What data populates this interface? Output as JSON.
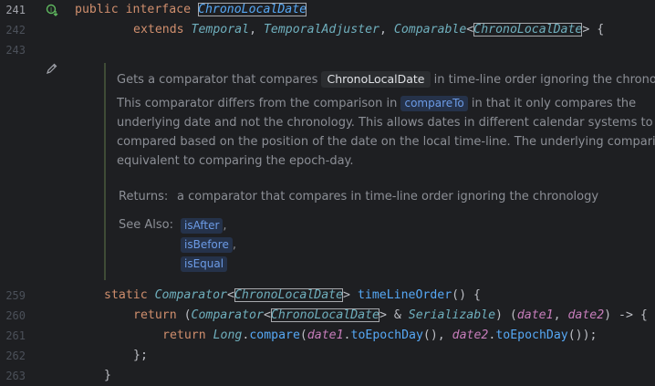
{
  "gutter": {
    "lines": [
      "241",
      "242",
      "243",
      "259",
      "260",
      "261",
      "262",
      "263"
    ]
  },
  "code": {
    "l241_kw1": "public",
    "l241_kw2": "interface",
    "l241_name": "ChronoLocalDate",
    "l242_kw": "extends",
    "l242_t1": "Temporal",
    "l242_t2": "TemporalAdjuster",
    "l242_t3": "Comparable",
    "l242_t4": "ChronoLocalDate",
    "l242_end": "> {",
    "l259_kw": "static",
    "l259_t1": "Comparator",
    "l259_t2": "ChronoLocalDate",
    "l259_fn": "timeLineOrder",
    "l259_end": "() {",
    "l260_kw": "return",
    "l260_t1": "Comparator",
    "l260_t2": "ChronoLocalDate",
    "l260_t3": "Serializable",
    "l260_p1": "date1",
    "l260_p2": "date2",
    "l261_kw": "return",
    "l261_cls": "Long",
    "l261_m1": "compare",
    "l261_a1": "date1",
    "l261_m2": "toEpochDay",
    "l261_a2": "date2",
    "l261_m3": "toEpochDay",
    "l262": "};",
    "l263": "}"
  },
  "doc": {
    "line1_pre": "Gets a comparator that compares",
    "line1_chip": "ChronoLocalDate",
    "line1_post": "in time-line order ignoring the chronology",
    "line2_pre": "This comparator differs from the comparison in",
    "line2_link": "compareTo",
    "line2_post": "in that it only compares the",
    "line3": "underlying date and not the chronology. This allows dates in different calendar systems to be",
    "line4": "compared based on the position of the date on the local time-line. The underlying comparison",
    "line5": "equivalent to comparing the epoch-day.",
    "returns_label": "Returns:",
    "returns_text": "a comparator that compares in time-line order ignoring the chronology",
    "see_also_label": "See Also:",
    "see_also": [
      "isAfter",
      "isBefore",
      "isEqual"
    ],
    "sep": ","
  },
  "icons": {
    "implementation": "implementation-marker-icon",
    "edit": "pencil-icon"
  },
  "colors": {
    "background": "#1e1f22",
    "keyword": "#cf8e6d",
    "interface": "#56a8f5",
    "type_param": "#c77dbb",
    "doc_text": "#8c8f96"
  }
}
